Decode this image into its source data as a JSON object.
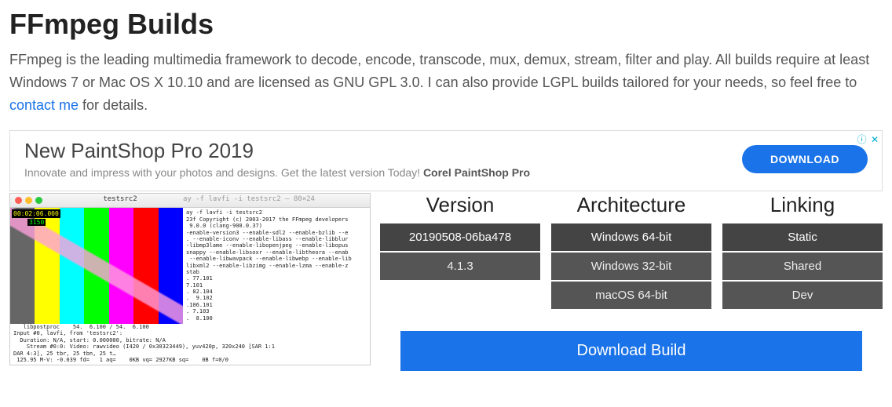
{
  "page": {
    "title": "FFmpeg Builds",
    "desc_a": "FFmpeg is the leading multimedia framework to decode, encode, transcode, mux, demux, stream, filter and play. All builds require at least Windows 7 or Mac OS X 10.10 and are licensed as GNU GPL 3.0. I can also provide LGPL builds tailored for your needs, so feel free to ",
    "desc_link": "contact me",
    "desc_b": " for details."
  },
  "ad": {
    "title": "New PaintShop Pro 2019",
    "subtitle": "Innovate and impress with your photos and designs. Get the latest version Today! ",
    "brand": "Corel PaintShop Pro",
    "button": "DOWNLOAD",
    "info_icon": "ⓘ",
    "close_icon": "✕"
  },
  "screenshot": {
    "title1": "testsrc2",
    "title2": "ay -f lavfi -i testsrc2 — 80×24",
    "timecode": "00:02:06.000",
    "frame": "3150",
    "terminal": "ay -f lavfi -i testsrc2\n23f Copyright (c) 2003-2017 the FFmpeg developers\n 9.0.0 (clang-900.0.37)\n-enable-version3 --enable-sdl2 --enable-bzlib --e\n. --enable-iconv --enable-libass --enable-libblur\n-libmp3lame --enable-libopenjpeg --enable-libopus\nsnappy --enable-libsoxr --enable-libtheora --enab\n --enable-libwavpack --enable-libwebp --enable-lib\nlibxml2 --enable-libzimg --enable-lzma --enable-z\nstab\n. 77.101\n7.101\n. 82.104\n.  9.102\n.106.101\n. 7.103\n.  8.100",
    "bottom": "   libpostproc    54.  6.100 / 54.  6.100\nInput #0, lavfi, from 'testsrc2':\n  Duration: N/A, start: 0.000000, bitrate: N/A\n    Stream #0:0: Video: rawvideo (I420 / 0x30323449), yuv420p, 320x240 [SAR 1:1\nDAR 4:3], 25 tbr, 25 tbn, 25 t…\n 125.95 M-V: -0.039 fd=   1 aq=    0KB vq= 2927KB sq=    0B f=0/0"
  },
  "cols": {
    "version": {
      "header": "Version",
      "options": [
        "20190508-06ba478",
        "4.1.3"
      ],
      "selected": 0
    },
    "arch": {
      "header": "Architecture",
      "options": [
        "Windows 64-bit",
        "Windows 32-bit",
        "macOS 64-bit"
      ],
      "selected": 0
    },
    "link": {
      "header": "Linking",
      "options": [
        "Static",
        "Shared",
        "Dev"
      ],
      "selected": 0
    }
  },
  "download": "Download Build"
}
